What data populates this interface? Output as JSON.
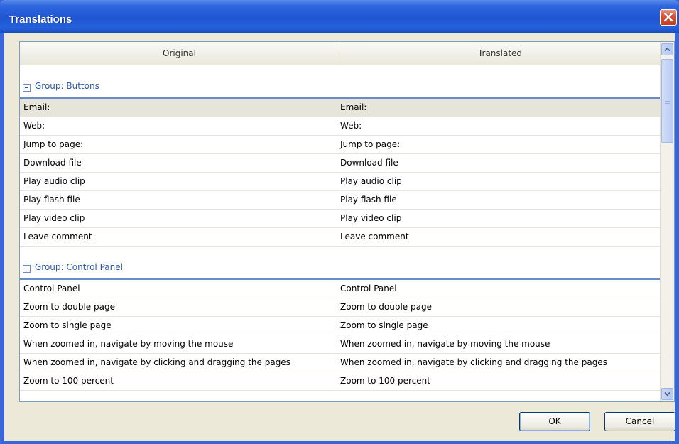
{
  "window": {
    "title": "Translations"
  },
  "columns": {
    "original": "Original",
    "translated": "Translated"
  },
  "groups": [
    {
      "label": "Group: Buttons",
      "rows": [
        {
          "original": "Email:",
          "translated": "Email:",
          "selected": true
        },
        {
          "original": "Web:",
          "translated": "Web:"
        },
        {
          "original": "Jump to page:",
          "translated": "Jump to page:"
        },
        {
          "original": "Download file",
          "translated": "Download file"
        },
        {
          "original": "Play audio clip",
          "translated": "Play audio clip"
        },
        {
          "original": "Play flash file",
          "translated": "Play flash file"
        },
        {
          "original": "Play video clip",
          "translated": "Play video clip"
        },
        {
          "original": "Leave comment",
          "translated": "Leave comment"
        }
      ]
    },
    {
      "label": "Group: Control Panel",
      "rows": [
        {
          "original": "Control Panel",
          "translated": "Control Panel"
        },
        {
          "original": "Zoom to double page",
          "translated": "Zoom to double page"
        },
        {
          "original": "Zoom to single page",
          "translated": "Zoom to single page"
        },
        {
          "original": "When zoomed in, navigate by moving the mouse",
          "translated": "When zoomed in, navigate by moving the mouse"
        },
        {
          "original": "When zoomed in, navigate by clicking and dragging the pages",
          "translated": "When zoomed in, navigate by clicking and dragging the pages"
        },
        {
          "original": "Zoom to 100 percent",
          "translated": "Zoom to 100 percent"
        }
      ]
    }
  ],
  "buttons": {
    "ok": "OK",
    "cancel": "Cancel"
  },
  "icons": {
    "close": "close-icon",
    "expander": "collapse-icon",
    "scroll_up": "scroll-up-arrow-icon",
    "scroll_down": "scroll-down-arrow-icon"
  },
  "colors": {
    "titlebar": "#2E66DF",
    "group_text": "#2D57A8",
    "selected_row": "#E7E4DA"
  }
}
